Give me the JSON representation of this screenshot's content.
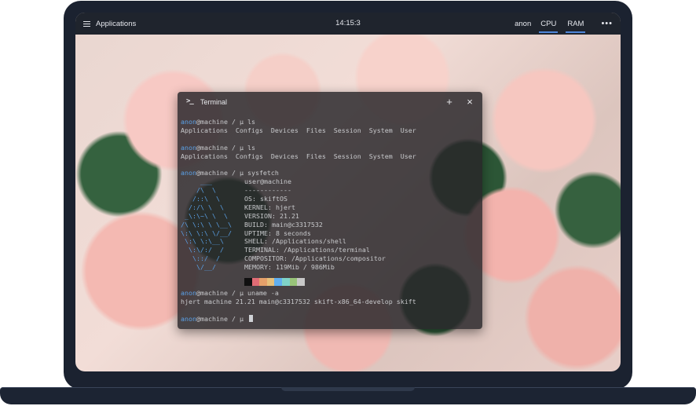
{
  "panel": {
    "menu_label": "Applications",
    "clock": "14:15:3",
    "user": "anon",
    "indicators": [
      "CPU",
      "RAM"
    ],
    "more": "•••"
  },
  "terminal": {
    "title": "Terminal",
    "title_icon": ">_",
    "add_glyph": "+",
    "close_glyph": "×",
    "prompt": {
      "user": "anon",
      "host": "@machine",
      "path": " / ",
      "mu": "µ "
    },
    "commands": [
      "ls",
      "ls",
      "sysfetch",
      "uname -a"
    ],
    "ls_output": "Applications  Configs  Devices  Files  Session  System  User",
    "sysfetch": {
      "logo": [
        "     ___",
        "    /\\  \\",
        "   /::\\  \\",
        "  /:/\\ \\  \\",
        " _\\:\\~\\ \\  \\",
        "/\\ \\:\\ \\ \\__\\",
        "\\:\\ \\:\\ \\/__/",
        " \\:\\ \\:\\__\\",
        "  \\:\\/:/  /",
        "   \\::/  /",
        "    \\/__/"
      ],
      "info": [
        "user@machine",
        "------------",
        "OS: skiftOS",
        "KERNEL: hjert",
        "VERSION: 21.21",
        "BUILD: main@c3317532",
        "UPTIME: 8 seconds",
        "SHELL: /Applications/shell",
        "TERMINAL: /Applications/terminal",
        "COMPOSITOR: /Applications/compositor",
        "MEMORY: 119Mib / 986Mib"
      ],
      "palette": [
        "#101010",
        "#e06c75",
        "#e5a06a",
        "#e5c07b",
        "#61afef",
        "#7fd3c8",
        "#98c379",
        "#c8c8c8"
      ]
    },
    "uname_output": "hjert machine 21.21 main@c3317532 skift-x86_64-develop skift"
  }
}
